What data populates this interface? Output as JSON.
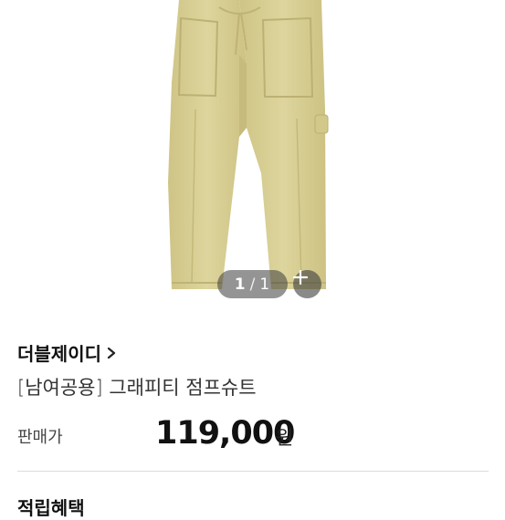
{
  "gallery": {
    "current_page": "1",
    "separator": "/",
    "total_pages": "1",
    "image_alt": "그래피티 점프슈트 상품 이미지",
    "product_color": "#d8cf8f"
  },
  "product": {
    "brand": "더블제이디",
    "name": "[남여공용] 그래피티 점프슈트",
    "price_label": "판매가",
    "price": "119,000",
    "price_unit": "원"
  },
  "next_section": {
    "title": "적립혜택"
  },
  "icons": {
    "zoom": "plus-icon",
    "brand_link": "chevron-right-icon"
  }
}
